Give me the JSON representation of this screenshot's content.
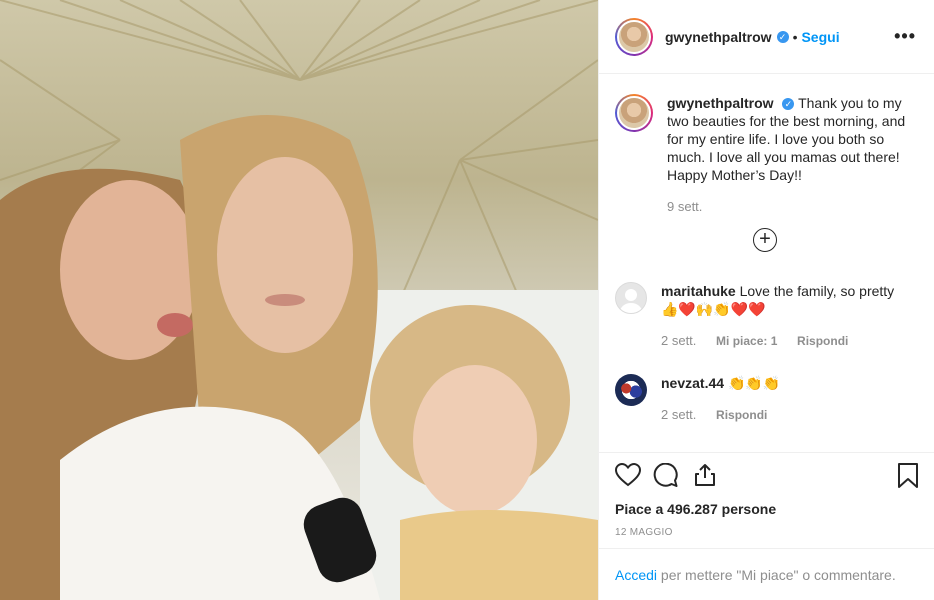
{
  "header": {
    "username": "gwynethpaltrow",
    "follow_label": "Segui",
    "more_icon": "more-horizontal-icon",
    "verified_icon": "verified-badge-icon"
  },
  "caption": {
    "username": "gwynethpaltrow",
    "text": "Thank you to my two beauties for the best morning, and for my entire life. I love you both so much. I love all you mamas out there! Happy Mother’s Day!!",
    "time": "9 sett."
  },
  "load_more_icon": "plus-circle-icon",
  "comments": [
    {
      "username": "maritahuke",
      "text": "Love the family, so pretty👍❤️🙌👏❤️❤️",
      "time": "2 sett.",
      "likes": "Mi piace: 1",
      "reply": "Rispondi"
    },
    {
      "username": "nevzat.44",
      "text": "👏👏👏",
      "time": "2 sett.",
      "reply": "Rispondi"
    }
  ],
  "actions": {
    "icons": [
      "heart-icon",
      "comment-icon",
      "share-icon",
      "bookmark-icon"
    ],
    "likes_text": "Piace a 496.287 persone",
    "date": "12 MAGGIO"
  },
  "login": {
    "link": "Accedi",
    "rest": " per mettere \"Mi piace\" o commentare."
  },
  "colors": {
    "accent": "#0095f6",
    "muted": "#8e8e8e",
    "text": "#262626"
  }
}
